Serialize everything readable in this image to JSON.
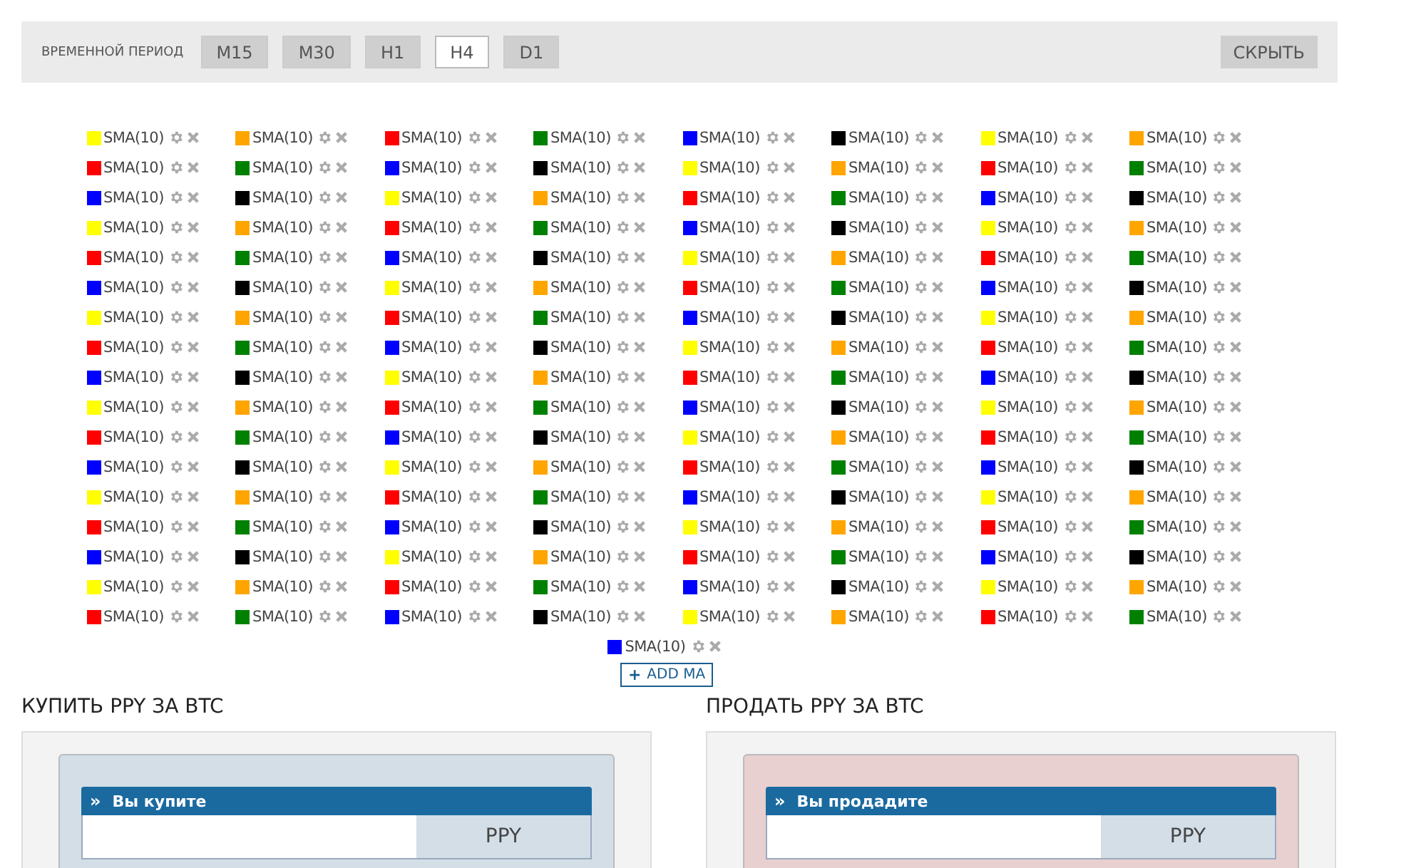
{
  "toolbar": {
    "label": "ВРЕМЕННОЙ ПЕРИОД",
    "periods": [
      {
        "label": "M15",
        "selected": false
      },
      {
        "label": "M30",
        "selected": false
      },
      {
        "label": "H1",
        "selected": false
      },
      {
        "label": "H4",
        "selected": true
      },
      {
        "label": "D1",
        "selected": false
      }
    ],
    "hide_button": "СКРЫТЬ"
  },
  "indicators": [
    {
      "label": "SMA(10)",
      "color": "#ffff00"
    },
    {
      "label": "SMA(10)",
      "color": "#ffa500"
    },
    {
      "label": "SMA(10)",
      "color": "#ff0000"
    },
    {
      "label": "SMA(10)",
      "color": "#008000"
    },
    {
      "label": "SMA(10)",
      "color": "#0000ff"
    },
    {
      "label": "SMA(10)",
      "color": "#000000"
    },
    {
      "label": "SMA(10)",
      "color": "#ffff00"
    },
    {
      "label": "SMA(10)",
      "color": "#ffa500"
    },
    {
      "label": "SMA(10)",
      "color": "#ff0000"
    },
    {
      "label": "SMA(10)",
      "color": "#008000"
    },
    {
      "label": "SMA(10)",
      "color": "#0000ff"
    },
    {
      "label": "SMA(10)",
      "color": "#000000"
    },
    {
      "label": "SMA(10)",
      "color": "#ffff00"
    },
    {
      "label": "SMA(10)",
      "color": "#ffa500"
    },
    {
      "label": "SMA(10)",
      "color": "#ff0000"
    },
    {
      "label": "SMA(10)",
      "color": "#008000"
    },
    {
      "label": "SMA(10)",
      "color": "#0000ff"
    },
    {
      "label": "SMA(10)",
      "color": "#000000"
    },
    {
      "label": "SMA(10)",
      "color": "#ffff00"
    },
    {
      "label": "SMA(10)",
      "color": "#ffa500"
    },
    {
      "label": "SMA(10)",
      "color": "#ff0000"
    },
    {
      "label": "SMA(10)",
      "color": "#008000"
    },
    {
      "label": "SMA(10)",
      "color": "#0000ff"
    },
    {
      "label": "SMA(10)",
      "color": "#000000"
    },
    {
      "label": "SMA(10)",
      "color": "#ffff00"
    },
    {
      "label": "SMA(10)",
      "color": "#ffa500"
    },
    {
      "label": "SMA(10)",
      "color": "#ff0000"
    },
    {
      "label": "SMA(10)",
      "color": "#008000"
    },
    {
      "label": "SMA(10)",
      "color": "#0000ff"
    },
    {
      "label": "SMA(10)",
      "color": "#000000"
    },
    {
      "label": "SMA(10)",
      "color": "#ffff00"
    },
    {
      "label": "SMA(10)",
      "color": "#ffa500"
    },
    {
      "label": "SMA(10)",
      "color": "#ff0000"
    },
    {
      "label": "SMA(10)",
      "color": "#008000"
    },
    {
      "label": "SMA(10)",
      "color": "#0000ff"
    },
    {
      "label": "SMA(10)",
      "color": "#000000"
    },
    {
      "label": "SMA(10)",
      "color": "#ffff00"
    },
    {
      "label": "SMA(10)",
      "color": "#ffa500"
    },
    {
      "label": "SMA(10)",
      "color": "#ff0000"
    },
    {
      "label": "SMA(10)",
      "color": "#008000"
    },
    {
      "label": "SMA(10)",
      "color": "#0000ff"
    },
    {
      "label": "SMA(10)",
      "color": "#000000"
    },
    {
      "label": "SMA(10)",
      "color": "#ffff00"
    },
    {
      "label": "SMA(10)",
      "color": "#ffa500"
    },
    {
      "label": "SMA(10)",
      "color": "#ff0000"
    },
    {
      "label": "SMA(10)",
      "color": "#008000"
    },
    {
      "label": "SMA(10)",
      "color": "#0000ff"
    },
    {
      "label": "SMA(10)",
      "color": "#000000"
    },
    {
      "label": "SMA(10)",
      "color": "#ffff00"
    },
    {
      "label": "SMA(10)",
      "color": "#ffa500"
    },
    {
      "label": "SMA(10)",
      "color": "#ff0000"
    },
    {
      "label": "SMA(10)",
      "color": "#008000"
    },
    {
      "label": "SMA(10)",
      "color": "#0000ff"
    },
    {
      "label": "SMA(10)",
      "color": "#000000"
    },
    {
      "label": "SMA(10)",
      "color": "#ffff00"
    },
    {
      "label": "SMA(10)",
      "color": "#ffa500"
    },
    {
      "label": "SMA(10)",
      "color": "#ff0000"
    },
    {
      "label": "SMA(10)",
      "color": "#008000"
    },
    {
      "label": "SMA(10)",
      "color": "#0000ff"
    },
    {
      "label": "SMA(10)",
      "color": "#000000"
    },
    {
      "label": "SMA(10)",
      "color": "#ffff00"
    },
    {
      "label": "SMA(10)",
      "color": "#ffa500"
    },
    {
      "label": "SMA(10)",
      "color": "#ff0000"
    },
    {
      "label": "SMA(10)",
      "color": "#008000"
    },
    {
      "label": "SMA(10)",
      "color": "#0000ff"
    },
    {
      "label": "SMA(10)",
      "color": "#000000"
    },
    {
      "label": "SMA(10)",
      "color": "#ffff00"
    },
    {
      "label": "SMA(10)",
      "color": "#ffa500"
    },
    {
      "label": "SMA(10)",
      "color": "#ff0000"
    },
    {
      "label": "SMA(10)",
      "color": "#008000"
    },
    {
      "label": "SMA(10)",
      "color": "#0000ff"
    },
    {
      "label": "SMA(10)",
      "color": "#000000"
    },
    {
      "label": "SMA(10)",
      "color": "#ffff00"
    },
    {
      "label": "SMA(10)",
      "color": "#ffa500"
    },
    {
      "label": "SMA(10)",
      "color": "#ff0000"
    },
    {
      "label": "SMA(10)",
      "color": "#008000"
    },
    {
      "label": "SMA(10)",
      "color": "#0000ff"
    },
    {
      "label": "SMA(10)",
      "color": "#000000"
    },
    {
      "label": "SMA(10)",
      "color": "#ffff00"
    },
    {
      "label": "SMA(10)",
      "color": "#ffa500"
    },
    {
      "label": "SMA(10)",
      "color": "#ff0000"
    },
    {
      "label": "SMA(10)",
      "color": "#008000"
    },
    {
      "label": "SMA(10)",
      "color": "#0000ff"
    },
    {
      "label": "SMA(10)",
      "color": "#000000"
    },
    {
      "label": "SMA(10)",
      "color": "#ffff00"
    },
    {
      "label": "SMA(10)",
      "color": "#ffa500"
    },
    {
      "label": "SMA(10)",
      "color": "#ff0000"
    },
    {
      "label": "SMA(10)",
      "color": "#008000"
    },
    {
      "label": "SMA(10)",
      "color": "#0000ff"
    },
    {
      "label": "SMA(10)",
      "color": "#000000"
    },
    {
      "label": "SMA(10)",
      "color": "#ffff00"
    },
    {
      "label": "SMA(10)",
      "color": "#ffa500"
    },
    {
      "label": "SMA(10)",
      "color": "#ff0000"
    },
    {
      "label": "SMA(10)",
      "color": "#008000"
    },
    {
      "label": "SMA(10)",
      "color": "#0000ff"
    },
    {
      "label": "SMA(10)",
      "color": "#000000"
    },
    {
      "label": "SMA(10)",
      "color": "#ffff00"
    },
    {
      "label": "SMA(10)",
      "color": "#ffa500"
    },
    {
      "label": "SMA(10)",
      "color": "#ff0000"
    },
    {
      "label": "SMA(10)",
      "color": "#008000"
    },
    {
      "label": "SMA(10)",
      "color": "#0000ff"
    },
    {
      "label": "SMA(10)",
      "color": "#000000"
    },
    {
      "label": "SMA(10)",
      "color": "#ffff00"
    },
    {
      "label": "SMA(10)",
      "color": "#ffa500"
    },
    {
      "label": "SMA(10)",
      "color": "#ff0000"
    },
    {
      "label": "SMA(10)",
      "color": "#008000"
    },
    {
      "label": "SMA(10)",
      "color": "#0000ff"
    },
    {
      "label": "SMA(10)",
      "color": "#000000"
    },
    {
      "label": "SMA(10)",
      "color": "#ffff00"
    },
    {
      "label": "SMA(10)",
      "color": "#ffa500"
    },
    {
      "label": "SMA(10)",
      "color": "#ff0000"
    },
    {
      "label": "SMA(10)",
      "color": "#008000"
    },
    {
      "label": "SMA(10)",
      "color": "#0000ff"
    },
    {
      "label": "SMA(10)",
      "color": "#000000"
    },
    {
      "label": "SMA(10)",
      "color": "#ffff00"
    },
    {
      "label": "SMA(10)",
      "color": "#ffa500"
    },
    {
      "label": "SMA(10)",
      "color": "#ff0000"
    },
    {
      "label": "SMA(10)",
      "color": "#008000"
    },
    {
      "label": "SMA(10)",
      "color": "#0000ff"
    },
    {
      "label": "SMA(10)",
      "color": "#000000"
    },
    {
      "label": "SMA(10)",
      "color": "#ffff00"
    },
    {
      "label": "SMA(10)",
      "color": "#ffa500"
    },
    {
      "label": "SMA(10)",
      "color": "#ff0000"
    },
    {
      "label": "SMA(10)",
      "color": "#008000"
    },
    {
      "label": "SMA(10)",
      "color": "#0000ff"
    },
    {
      "label": "SMA(10)",
      "color": "#000000"
    },
    {
      "label": "SMA(10)",
      "color": "#ffff00"
    },
    {
      "label": "SMA(10)",
      "color": "#ffa500"
    },
    {
      "label": "SMA(10)",
      "color": "#ff0000"
    },
    {
      "label": "SMA(10)",
      "color": "#008000"
    },
    {
      "label": "SMA(10)",
      "color": "#0000ff"
    },
    {
      "label": "SMA(10)",
      "color": "#000000"
    },
    {
      "label": "SMA(10)",
      "color": "#ffff00"
    },
    {
      "label": "SMA(10)",
      "color": "#ffa500"
    },
    {
      "label": "SMA(10)",
      "color": "#ff0000"
    },
    {
      "label": "SMA(10)",
      "color": "#008000"
    },
    {
      "label": "SMA(10)",
      "color": "#0000ff"
    }
  ],
  "add_button": {
    "icon": "+",
    "label": "ADD MA"
  },
  "trade_panels": [
    {
      "kind": "buy",
      "title": "КУПИТЬ PPY ЗА BTC",
      "field_label": "Вы купите",
      "marker": "»",
      "currency": "PPY"
    },
    {
      "kind": "sell",
      "title": "ПРОДАТЬ PPY ЗА BTC",
      "field_label": "Вы продадите",
      "marker": "»",
      "currency": "PPY"
    }
  ]
}
